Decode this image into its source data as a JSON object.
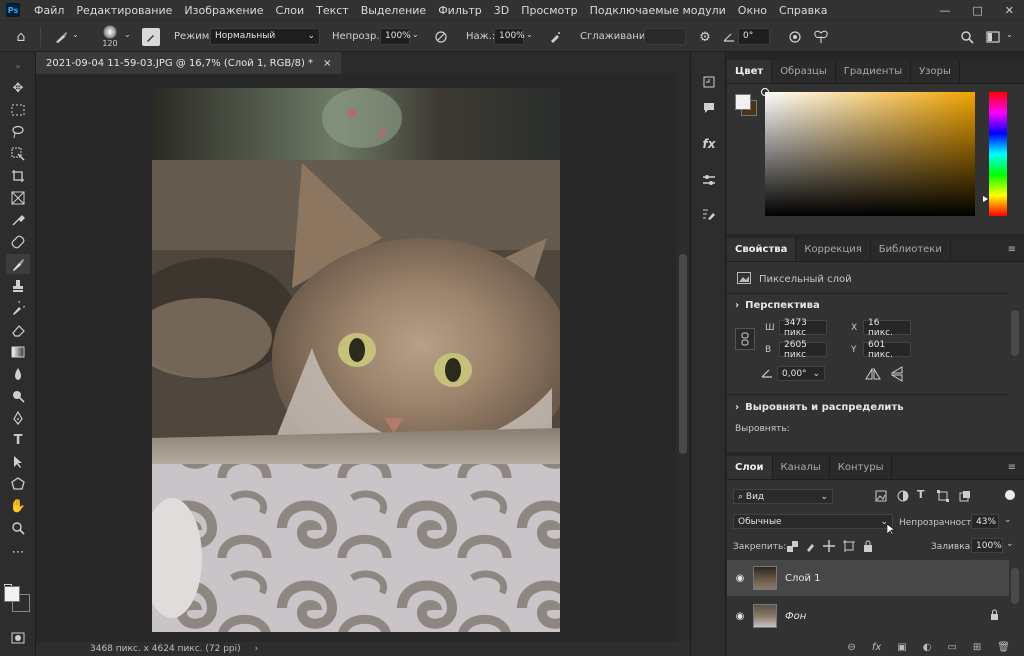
{
  "menu": {
    "app_icon": "Ps",
    "items": [
      "Файл",
      "Редактирование",
      "Изображение",
      "Слои",
      "Текст",
      "Выделение",
      "Фильтр",
      "3D",
      "Просмотр",
      "Подключаемые модули",
      "Окно",
      "Справка"
    ],
    "window_buttons": [
      "—",
      "□",
      "✕"
    ]
  },
  "options": {
    "brush_size": "120",
    "mode_label": "Режим:",
    "mode_value": "Нормальный",
    "opacity_label": "Непрозр.:",
    "opacity_value": "100%",
    "flow_label": "Наж.:",
    "flow_value": "100%",
    "smoothing_label": "Сглаживание:",
    "smoothing_value": "",
    "angle_value": "0°"
  },
  "document": {
    "tab_title": "2021-09-04 11-59-03.JPG @ 16,7% (Слой 1, RGB/8) *",
    "close": "×",
    "status": "3468 пикс. x 4624 пикс. (72 ppi)"
  },
  "color_panel": {
    "tabs": [
      "Цвет",
      "Образцы",
      "Градиенты",
      "Узоры"
    ],
    "active_tab": 0,
    "fg_color": "#f2f2f2",
    "bg_color": "#4a3418",
    "hue_color": "#f0a400"
  },
  "properties_panel": {
    "tabs": [
      "Свойства",
      "Коррекция",
      "Библиотеки"
    ],
    "active_tab": 0,
    "layer_type": "Пиксельный слой",
    "section_perspective": "Перспектива",
    "w_label": "Ш",
    "w_value": "3473 пикс",
    "h_label": "В",
    "h_value": "2605 пикс",
    "x_label": "X",
    "x_value": "16 пикс.",
    "y_label": "Y",
    "y_value": "601 пикс.",
    "angle_value": "0,00°",
    "section_align": "Выровнять и распределить",
    "align_label": "Выровнять:"
  },
  "layers_panel": {
    "tabs": [
      "Слои",
      "Каналы",
      "Контуры"
    ],
    "active_tab": 0,
    "filter_kind": "Вид",
    "blend_mode": "Обычные",
    "opacity_label": "Непрозрачность:",
    "opacity_value": "43%",
    "lock_label": "Закрепить:",
    "fill_label": "Заливка:",
    "fill_value": "100%",
    "layers": [
      {
        "name": "Слой 1",
        "selected": true
      },
      {
        "name": "Фон",
        "selected": false,
        "locked": true
      }
    ]
  }
}
